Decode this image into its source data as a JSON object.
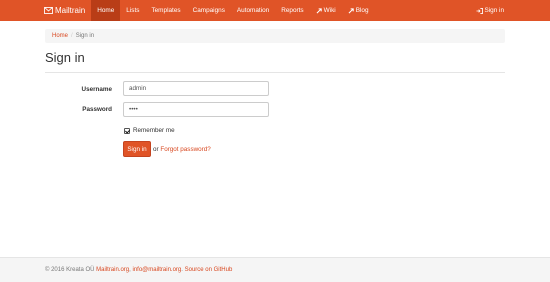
{
  "brand": {
    "name": "Mailtrain",
    "icon": "envelope-icon"
  },
  "nav": {
    "items": [
      {
        "label": "Home",
        "active": true
      },
      {
        "label": "Lists"
      },
      {
        "label": "Templates"
      },
      {
        "label": "Campaigns"
      },
      {
        "label": "Automation"
      },
      {
        "label": "Reports"
      },
      {
        "label": "Wiki",
        "icon": "external-link-icon"
      },
      {
        "label": "Blog",
        "icon": "external-link-icon"
      }
    ],
    "signin": {
      "label": "Sign in",
      "icon": "sign-in-icon"
    }
  },
  "breadcrumb": {
    "home": "Home",
    "separator": "/",
    "current": "Sign in"
  },
  "page": {
    "title": "Sign in"
  },
  "form": {
    "username_label": "Username",
    "username_value": "admin",
    "password_label": "Password",
    "password_value": "••••",
    "remember_label": "Remember me",
    "remember_checked": true,
    "submit_label": "Sign in",
    "or_text": "or",
    "forgot_label": "Forgot password?"
  },
  "footer": {
    "copyright": "© 2016 Kreata OÜ",
    "site_link": "Mailtrain.org",
    "email_link": "info@mailtrain.org",
    "source_link": "Source on GitHub"
  },
  "colors": {
    "primary": "#e05427",
    "primary_dark": "#b93d17",
    "link": "#d8471f"
  }
}
